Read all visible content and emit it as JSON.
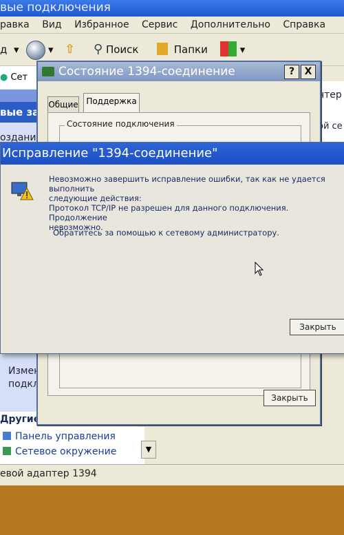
{
  "explorer": {
    "title_fragment": "вые подключения",
    "menu": [
      "равка",
      "Вид",
      "Избранное",
      "Сервис",
      "Дополнительно",
      "Справка"
    ],
    "toolbar": {
      "back_fragment": "д",
      "search_label": "Поиск",
      "folders_label": "Папки"
    },
    "address_fragment": "Сет",
    "left_panel": {
      "tasks_header_fragment": "вые за",
      "create_fragment": "оздание",
      "change_fragment_1": "Изменен",
      "change_fragment_2": "подключе",
      "other_places_header": "Другие мес",
      "places": [
        "Панель управления",
        "Сетевое окружение"
      ]
    },
    "right_fragment_1": "нтер",
    "right_fragment_2": "ой се",
    "statusbar_text": "евой адаптер 1394"
  },
  "status_dialog": {
    "title": "Состояние 1394-соединение",
    "help_btn": "?",
    "close_btn": "X",
    "tabs": [
      "Общие",
      "Поддержка"
    ],
    "group_label": "Состояние подключения",
    "close_button": "Закрыть"
  },
  "repair_dialog": {
    "title": "Исправление \"1394-соединение\"",
    "message_line1": "Невозможно завершить исправление ошибки, так как не удается выполнить",
    "message_line2": "следующие действия:",
    "message_line3": "Протокол TCP/IP не разрешен для данного подключения. Продолжение",
    "message_line4": "невозможно.",
    "hint": "Обратитесь за помощью к сетевому администратору.",
    "close_button": "Закрыть"
  },
  "colors": {
    "title_blue": "#1f56cf",
    "inactive_title": "#7f97c1",
    "dialog_text": "#1a2c66",
    "desktop_orange": "#b8781f"
  }
}
